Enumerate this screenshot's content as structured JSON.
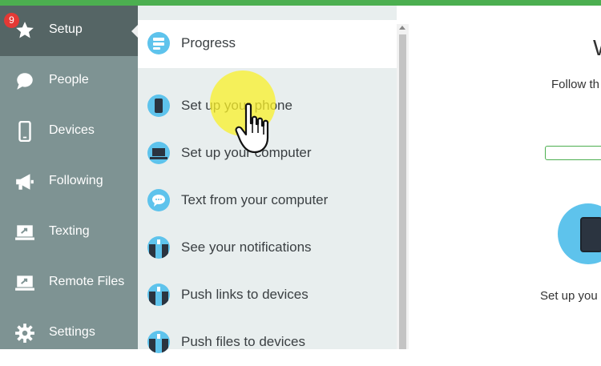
{
  "nav": {
    "badge": "9",
    "items": [
      {
        "label": "Setup",
        "icon": "star-icon"
      },
      {
        "label": "People",
        "icon": "chat-bubble-icon"
      },
      {
        "label": "Devices",
        "icon": "phone-icon"
      },
      {
        "label": "Following",
        "icon": "megaphone-icon"
      },
      {
        "label": "Texting",
        "icon": "laptop-icon"
      },
      {
        "label": "Remote Files",
        "icon": "laptop-icon"
      },
      {
        "label": "Settings",
        "icon": "gear-icon"
      }
    ]
  },
  "submenu": {
    "header": "Progress",
    "items": [
      {
        "label": "Set up your phone",
        "icon": "phone-icon"
      },
      {
        "label": "Set up your computer",
        "icon": "laptop-icon"
      },
      {
        "label": "Text from your computer",
        "icon": "chat-bubble-icon"
      },
      {
        "label": "See your notifications",
        "icon": "notifications-icon"
      },
      {
        "label": "Push links to devices",
        "icon": "push-icon"
      },
      {
        "label": "Push files to devices",
        "icon": "push-icon"
      }
    ]
  },
  "content": {
    "heading": "W",
    "follow_text": "Follow th",
    "setup_text": "Set up you"
  },
  "colors": {
    "accent": "#4caf50",
    "nav_bg": "#7e9393",
    "nav_active": "#556565",
    "icon_blue": "#5ec3ec",
    "badge": "#e53935"
  }
}
